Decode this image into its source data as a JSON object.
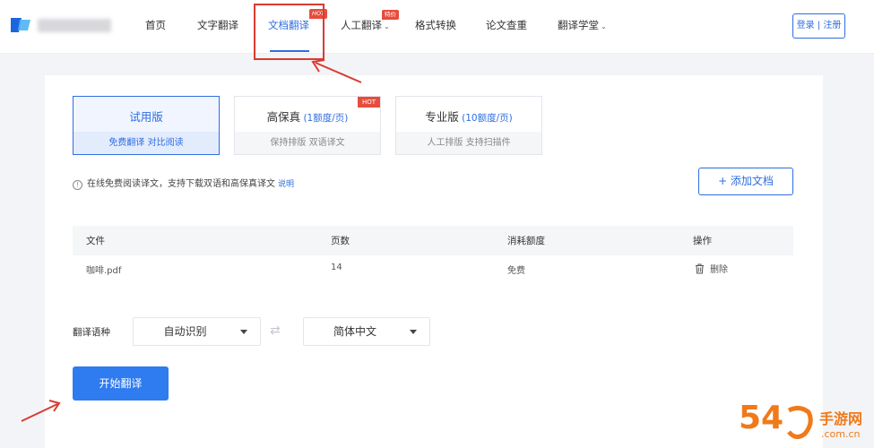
{
  "header": {
    "nav": [
      {
        "label": "首页"
      },
      {
        "label": "文字翻译"
      },
      {
        "label": "文档翻译",
        "tag": "HOT"
      },
      {
        "label": "人工翻译",
        "tag": "特价"
      },
      {
        "label": "格式转换"
      },
      {
        "label": "论文查重"
      },
      {
        "label": "翻译学堂"
      }
    ],
    "login": "登录 | 注册"
  },
  "plans": [
    {
      "title": "试用版",
      "sub": "",
      "desc": "免费翻译  对比阅读",
      "selected": true
    },
    {
      "title": "高保真",
      "sub": " (1额度/页)",
      "desc": "保持排版  双语译文",
      "tag": "HOT"
    },
    {
      "title": "专业版",
      "sub": " (10额度/页)",
      "desc": "人工排版  支持扫描件"
    }
  ],
  "info": {
    "text": "在线免费阅读译文，支持下载双语和高保真译文",
    "link": "说明"
  },
  "add_button": "+ 添加文档",
  "table": {
    "headers": [
      "文件",
      "页数",
      "消耗额度",
      "操作"
    ],
    "rows": [
      {
        "file": "咖啡.pdf",
        "pages": "14",
        "cost": "免费",
        "action": "删除"
      }
    ]
  },
  "language": {
    "label": "翻译语种",
    "source": "自动识别",
    "target": "简体中文",
    "swap_glyph": "⇄"
  },
  "start_button": "开始翻译",
  "watermark": {
    "main": "54",
    "side": "手游网",
    "url": ".com.cn"
  },
  "colors": {
    "accent": "#2f6ee0",
    "primary_button": "#2f7bf0",
    "hot_tag": "#e74c3c",
    "annotation": "#d93b30",
    "watermark": "#f07a1a"
  }
}
